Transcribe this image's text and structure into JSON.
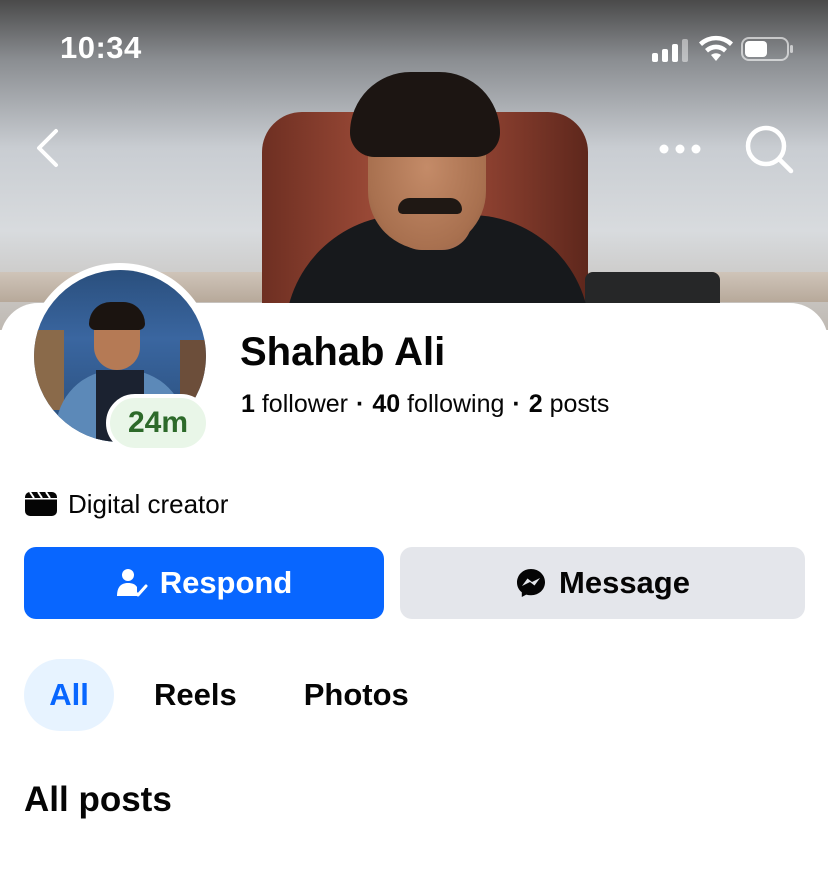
{
  "status_bar": {
    "time": "10:34",
    "icons": [
      "signal-icon",
      "wifi-icon",
      "battery-icon"
    ]
  },
  "header": {
    "icons": [
      "back-icon",
      "more-icon",
      "search-icon"
    ]
  },
  "profile": {
    "name": "Shahab Ali",
    "active_badge": "24m",
    "stats": {
      "followers_count": "1",
      "followers_label": "follower",
      "following_count": "40",
      "following_label": "following",
      "posts_count": "2",
      "posts_label": "posts",
      "separator": "·"
    },
    "category": "Digital creator",
    "category_icon": "clapperboard-icon"
  },
  "actions": {
    "respond_label": "Respond",
    "respond_icon": "friend-respond-icon",
    "message_label": "Message",
    "message_icon": "messenger-icon"
  },
  "tabs": {
    "items": [
      {
        "label": "All",
        "selected": true
      },
      {
        "label": "Reels",
        "selected": false
      },
      {
        "label": "Photos",
        "selected": false
      }
    ]
  },
  "main": {
    "section_title": "All posts"
  },
  "colors": {
    "accent": "#0866ff",
    "secondary_button": "#e4e6eb",
    "active_badge_text": "#2d6a2a",
    "active_badge_bg": "#e9f6e8",
    "tab_selected_bg": "#e7f3ff"
  }
}
